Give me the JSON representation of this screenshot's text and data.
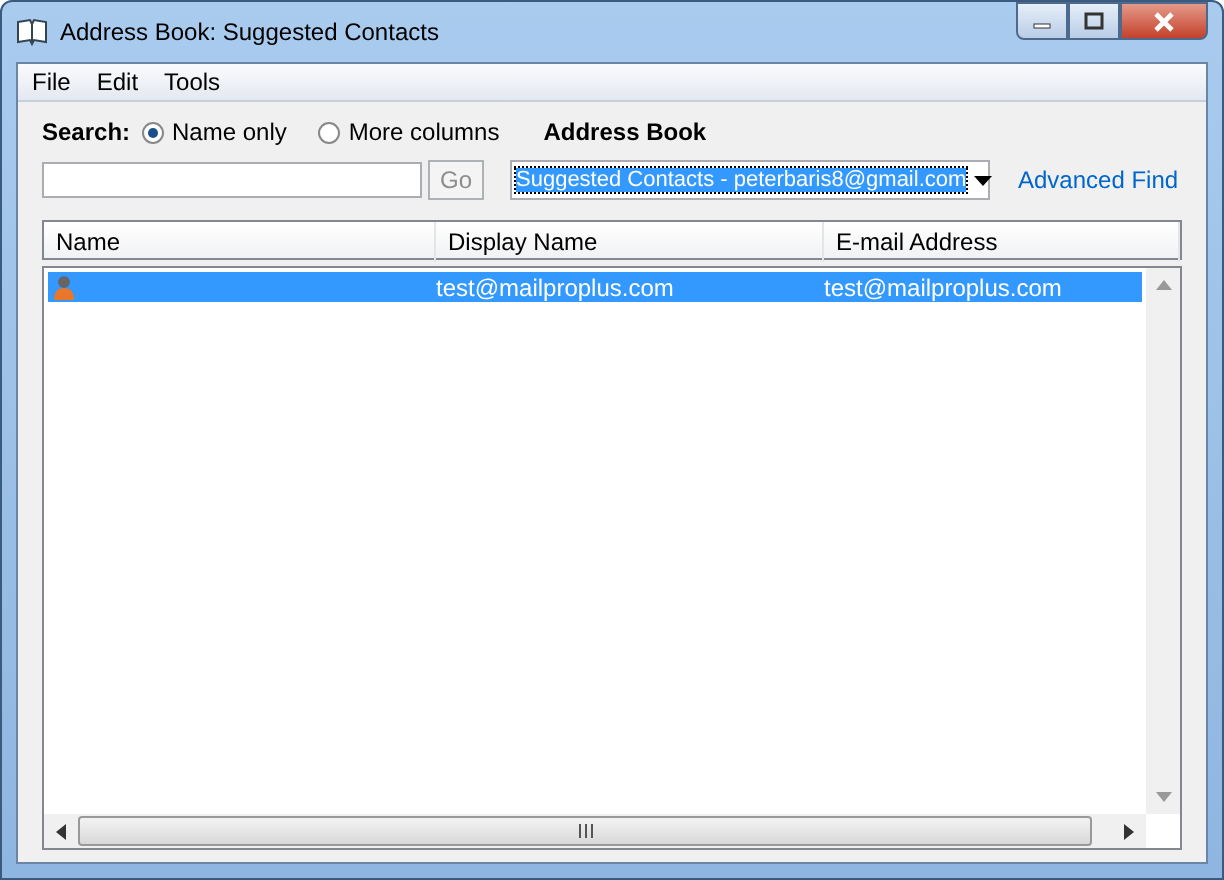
{
  "window": {
    "title": "Address Book: Suggested Contacts"
  },
  "menu": [
    "File",
    "Edit",
    "Tools"
  ],
  "search": {
    "label": "Search:",
    "options": [
      {
        "label": "Name only",
        "selected": true
      },
      {
        "label": "More columns",
        "selected": false
      }
    ],
    "go_button": {
      "label": "Go",
      "disabled": true
    }
  },
  "address_book": {
    "label": "Address Book",
    "value": "Suggested Contacts - peterbaris8@gmail.com",
    "advanced_find": "Advanced Find"
  },
  "table": {
    "columns": [
      "Name",
      "Display Name",
      "E-mail Address"
    ],
    "rows": [
      {
        "selected": true,
        "cells": [
          "",
          "test@mailproplus.com",
          "test@mailproplus.com"
        ]
      }
    ]
  }
}
